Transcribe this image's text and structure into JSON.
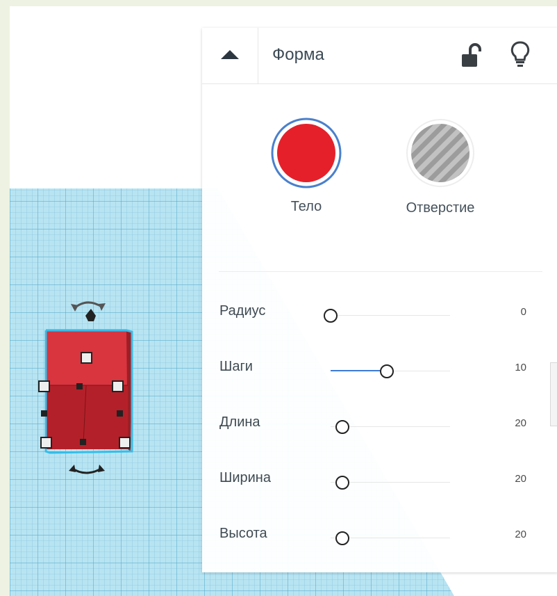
{
  "panel": {
    "title": "Форма",
    "icons": {
      "collapse": "caret-up-icon",
      "lock": "unlocked-padlock-icon",
      "light": "lightbulb-icon"
    }
  },
  "shape_types": [
    {
      "label": "Тело",
      "selected": true,
      "color": "#e5202a"
    },
    {
      "label": "Отверстие",
      "selected": false,
      "color": "#b5b5b5"
    }
  ],
  "params": [
    {
      "label": "Радиус",
      "value": "0",
      "fraction": 0.0
    },
    {
      "label": "Шаги",
      "value": "10",
      "fraction": 0.47
    },
    {
      "label": "Длина",
      "value": "20",
      "fraction": 0.1
    },
    {
      "label": "Ширина",
      "value": "20",
      "fraction": 0.1
    },
    {
      "label": "Высота",
      "value": "20",
      "fraction": 0.1
    }
  ],
  "colors": {
    "accent": "#3d7bd6",
    "solid": "#e5202a",
    "grid": "#8fd0e6",
    "cube": "#d9303a"
  }
}
